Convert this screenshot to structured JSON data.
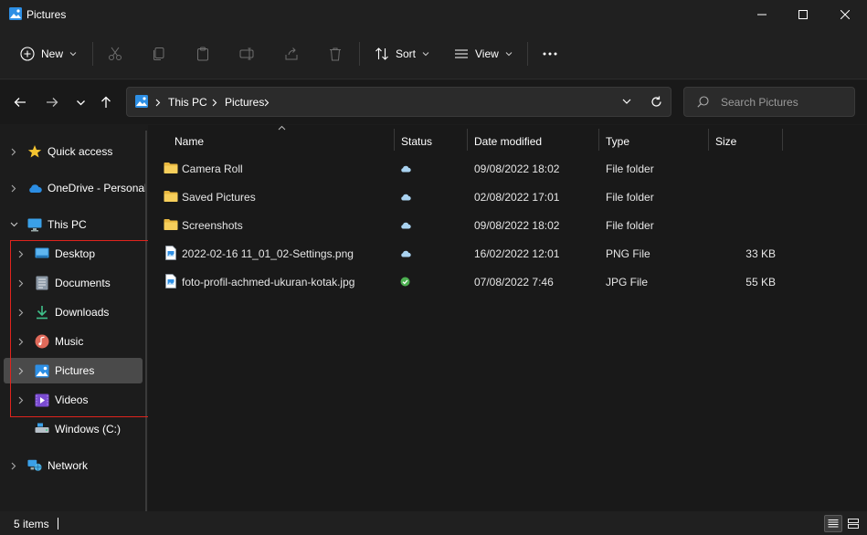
{
  "window": {
    "title": "Pictures"
  },
  "toolbar": {
    "new_label": "New",
    "sort_label": "Sort",
    "view_label": "View"
  },
  "address": {
    "crumbs": [
      "This PC",
      "Pictures"
    ]
  },
  "search": {
    "placeholder": "Search Pictures"
  },
  "sidebar": {
    "items": [
      {
        "label": "Quick access",
        "icon": "star-icon"
      },
      {
        "label": "OneDrive - Personal",
        "icon": "onedrive-cloud-icon"
      },
      {
        "label": "This PC",
        "icon": "monitor-icon"
      },
      {
        "label": "Desktop",
        "icon": "desktop-icon"
      },
      {
        "label": "Documents",
        "icon": "documents-icon"
      },
      {
        "label": "Downloads",
        "icon": "download-icon"
      },
      {
        "label": "Music",
        "icon": "music-icon"
      },
      {
        "label": "Pictures",
        "icon": "pictures-icon"
      },
      {
        "label": "Videos",
        "icon": "videos-icon"
      },
      {
        "label": "Windows (C:)",
        "icon": "drive-icon"
      },
      {
        "label": "Network",
        "icon": "network-icon"
      }
    ]
  },
  "columns": {
    "name": "Name",
    "status": "Status",
    "date": "Date modified",
    "type": "Type",
    "size": "Size"
  },
  "files": [
    {
      "name": "Camera Roll",
      "status": "cloud",
      "date": "09/08/2022 18:02",
      "type": "File folder",
      "size": "",
      "icon": "folder-icon"
    },
    {
      "name": "Saved Pictures",
      "status": "cloud",
      "date": "02/08/2022 17:01",
      "type": "File folder",
      "size": "",
      "icon": "folder-icon"
    },
    {
      "name": "Screenshots",
      "status": "cloud",
      "date": "09/08/2022 18:02",
      "type": "File folder",
      "size": "",
      "icon": "folder-icon"
    },
    {
      "name": "2022-02-16 11_01_02-Settings.png",
      "status": "cloud",
      "date": "16/02/2022 12:01",
      "type": "PNG File",
      "size": "33 KB",
      "icon": "image-file-icon"
    },
    {
      "name": "foto-profil-achmed-ukuran-kotak.jpg",
      "status": "synced",
      "date": "07/08/2022 7:46",
      "type": "JPG File",
      "size": "55 KB",
      "icon": "image-file-icon"
    }
  ],
  "statusbar": {
    "count": "5 items"
  },
  "colors": {
    "accent": "#0078d4",
    "folder": "#f0c14b",
    "cloud": "#a9d2f0",
    "synced": "#4caf50",
    "highlight": "#e0241d"
  }
}
